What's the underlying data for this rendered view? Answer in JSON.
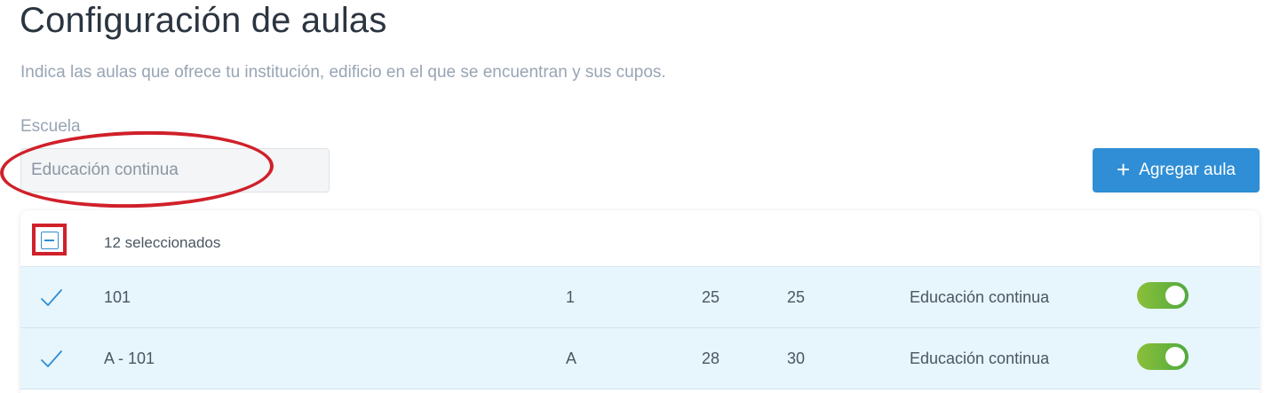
{
  "page": {
    "title": "Configuración de aulas",
    "subtitle": "Indica las aulas que ofrece tu institución, edificio en el que se encuentran y sus cupos."
  },
  "school_field": {
    "label": "Escuela",
    "value": "",
    "placeholder": "Educación continua"
  },
  "add_button": {
    "icon": "plus-icon",
    "label": "Agregar aula"
  },
  "table": {
    "header": {
      "checkbox_state": "indeterminate",
      "selected_text": "12 seleccionados"
    },
    "rows": [
      {
        "selected": true,
        "name": "101",
        "building": "1",
        "capacity_a": "25",
        "capacity_b": "25",
        "school": "Educación continua",
        "active": true
      },
      {
        "selected": true,
        "name": "A - 101",
        "building": "A",
        "capacity_a": "28",
        "capacity_b": "30",
        "school": "Educación continua",
        "active": true
      }
    ]
  },
  "colors": {
    "accent": "#2f8ed5",
    "row_selected_bg": "#e7f5fd",
    "toggle_on_start": "#8cbf3a",
    "toggle_on_end": "#4faa3e",
    "annotation_red": "#d0202a"
  }
}
